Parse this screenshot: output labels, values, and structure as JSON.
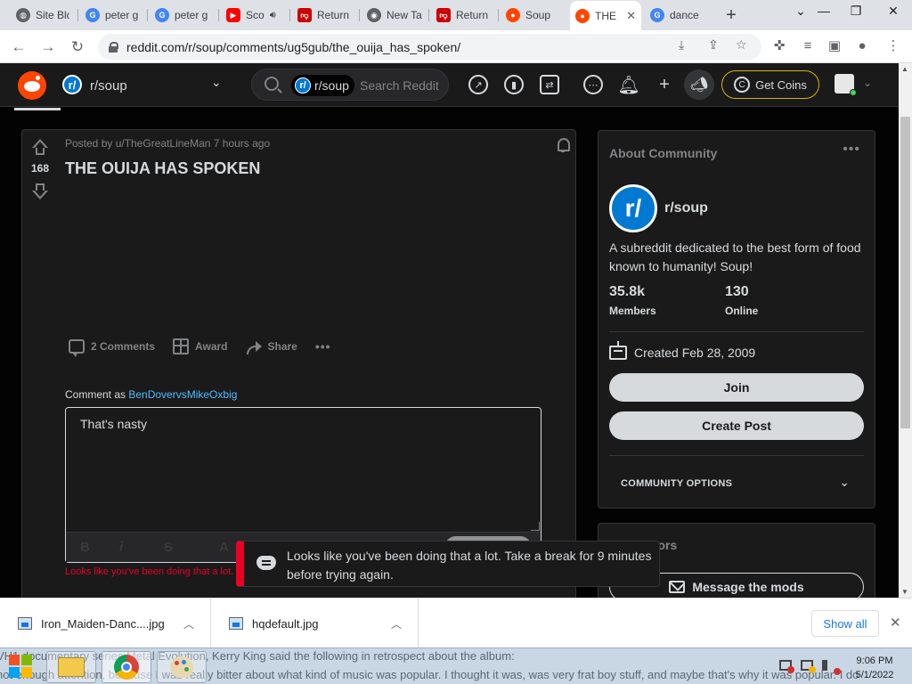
{
  "browser": {
    "tabs": [
      {
        "label": "Site Blo",
        "icon": "globe-icon",
        "color": "#5f6368"
      },
      {
        "label": "peter g",
        "icon": "google-icon",
        "color": "#4285f4"
      },
      {
        "label": "peter g",
        "icon": "google-icon",
        "color": "#4285f4"
      },
      {
        "label": "Sco",
        "icon": "youtube-icon",
        "color": "#ff0000"
      },
      {
        "label": "Return",
        "icon": "dislike-icon",
        "color": "#cc0000"
      },
      {
        "label": "New Ta",
        "icon": "chrome-icon",
        "color": "#5f6368"
      },
      {
        "label": "Return",
        "icon": "dislike-icon",
        "color": "#cc0000"
      },
      {
        "label": "Soup",
        "icon": "reddit-icon",
        "color": "#ff4500"
      },
      {
        "label": "THE",
        "icon": "reddit-icon",
        "color": "#ff4500"
      },
      {
        "label": "dance",
        "icon": "google-icon",
        "color": "#4285f4"
      }
    ],
    "url": "reddit.com/r/soup/comments/ug5gub/the_ouija_has_spoken/"
  },
  "reddit_header": {
    "community": "r/soup",
    "search_scope": "r/soup",
    "search_placeholder": "Search Reddit",
    "coins_label": "Get Coins"
  },
  "post": {
    "score": "168",
    "posted_by": "Posted by u/TheGreatLineMan 7 hours ago",
    "title": "THE OUIJA HAS SPOKEN",
    "comments_label": "2 Comments",
    "award_label": "Award",
    "share_label": "Share",
    "comment_as_prefix": "Comment as ",
    "username": "BenDovervsMikeOxbig",
    "comment_text": "That's nasty",
    "error_text": "Looks like you've been doing that a lot."
  },
  "sidebar": {
    "about_title": "About Community",
    "sub_name": "r/soup",
    "description": "A subreddit dedicated to the best form of food known to humanity! Soup!",
    "members_count": "35.8k",
    "members_label": "Members",
    "online_count": "130",
    "online_label": "Online",
    "created": "Created Feb 28, 2009",
    "join_label": "Join",
    "create_post_label": "Create Post",
    "community_options_label": "COMMUNITY OPTIONS",
    "moderators_title": "Moderators",
    "message_mods_label": "Message the mods"
  },
  "toast": {
    "message": "Looks like you've been doing that a lot. Take a break for 9 minutes before trying again."
  },
  "downloads": {
    "items": [
      "Iron_Maiden-Danc....jpg",
      "hqdefault.jpg"
    ],
    "show_all": "Show all"
  },
  "taskbar": {
    "background_line1": "VH1 documentary series Metal Evolution, Kerry King said the following in retrospect about the album:",
    "background_line2": "not enough attention, because I was really bitter about what kind of music was popular. I thought it was, was very frat boy stuff, and maybe that's why it was popular. I do",
    "time": "9:06 PM",
    "date": "5/1/2022"
  }
}
